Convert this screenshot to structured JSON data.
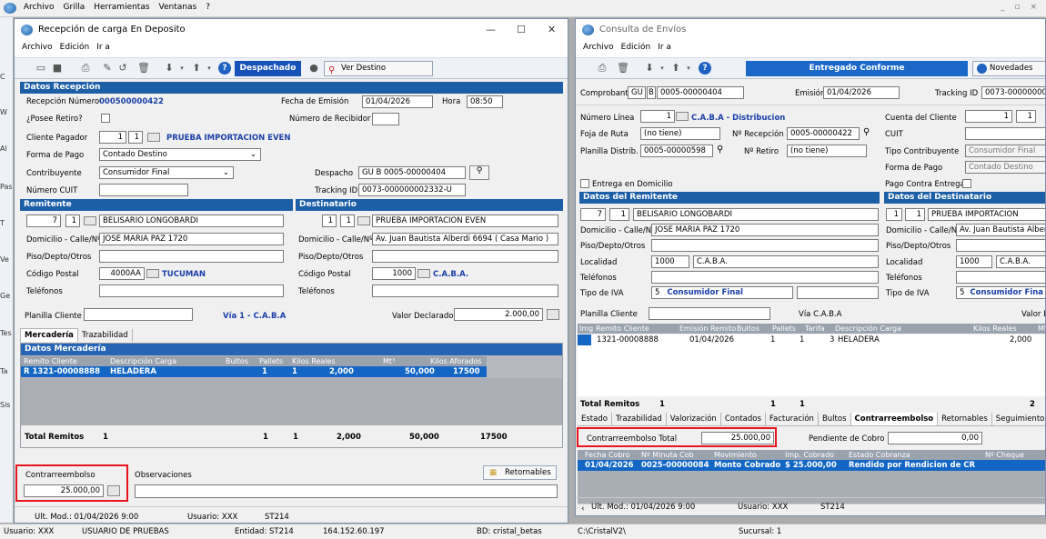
{
  "app": {
    "menu": [
      "Archivo",
      "Grilla",
      "Herramientas",
      "Ventanas",
      "?"
    ],
    "win_controls": "_ ▫ ×"
  },
  "sidebar": [
    "C",
    "W",
    "Al",
    "Pas",
    "T",
    "Ve",
    "Ge",
    "Tes",
    "Ta",
    "Sis"
  ],
  "left": {
    "title": "Recepción de carga En Deposito",
    "menu": [
      "Archivo",
      "Edición",
      "Ir a"
    ],
    "toolbar": {
      "status_label": "Despachado",
      "dest_label": "Ver Destino"
    },
    "datos": {
      "section": "Datos Recepción",
      "recep_label": "Recepción Número",
      "recep_val": "000500000422",
      "fecha_label": "Fecha de Emisión",
      "fecha_val": "01/04/2026",
      "hora_label": "Hora",
      "hora_val": "08:50",
      "retiro_label": "¿Posee Retiro?",
      "recibidor_label": "Número de Recibidor",
      "pagador_label": "Cliente Pagador",
      "pagador_n1": "1",
      "pagador_n2": "1",
      "pagador_name": "PRUEBA IMPORTACION EVEN",
      "forma_label": "Forma de Pago",
      "forma_val": "Contado Destino",
      "contrib_label": "Contribuyente",
      "contrib_val": "Consumidor Final",
      "despacho_label": "Despacho",
      "despacho_val": "GU B 0005-00000404",
      "cuit_label": "Número CUIT",
      "tracking_label": "Tracking ID",
      "tracking_val": "0073-000000002332-U"
    },
    "remitente": {
      "section": "Remitente",
      "n1": "7",
      "n2": "1",
      "name": "BELISARIO LONGOBARDI",
      "dom_label": "Domicilio - Calle/Nº",
      "dom": "JOSE MARIA PAZ 1720",
      "piso_label": "Piso/Depto/Otros",
      "cp_label": "Código Postal",
      "cp": "4000AA",
      "city": "TUCUMAN",
      "tel_label": "Teléfonos"
    },
    "destinatario": {
      "section": "Destinatario",
      "n1": "1",
      "n2": "1",
      "name": "PRUEBA IMPORTACION EVEN",
      "dom_label": "Domicilio - Calle/Nº",
      "dom": "Av. Juan Bautista Alberdi 6694 ( Casa Mario )",
      "piso_label": "Piso/Depto/Otros",
      "cp_label": "Código Postal",
      "cp": "1000",
      "city": "C.A.B.A.",
      "tel_label": "Teléfonos"
    },
    "planilla_label": "Planilla Cliente",
    "via": "Vía  1 - C.A.B.A",
    "valor_label": "Valor Declarado",
    "valor": "2.000,00",
    "tabs": [
      "Mercadería",
      "Trazabilidad"
    ],
    "merc": {
      "section": "Datos Mercadería",
      "headers": [
        "Remito Cliente",
        "Descripción Carga",
        "Bultos",
        "Pallets",
        "Kilos Reales",
        "Mt³",
        "Kilos Aforados"
      ],
      "row": [
        "R 1321-00008888",
        "HELADERA",
        "1",
        "1",
        "2,000",
        "50,000",
        "17500"
      ],
      "totals_label": "Total Remitos",
      "totals": [
        "1",
        "1",
        "1",
        "2,000",
        "50,000",
        "17500"
      ]
    },
    "contra_label": "Contrarreembolso",
    "contra_val": "25.000,00",
    "obs_label": "Observaciones",
    "retornables": "Retornables",
    "status": {
      "mod": "Ult. Mod.: 01/04/2026 9:00",
      "user": "Usuario: XXX",
      "code": "ST214"
    }
  },
  "right": {
    "title": "Consulta de Envíos",
    "menu": [
      "Archivo",
      "Edición",
      "Ir a"
    ],
    "toolbar": {
      "status_label": "Entregado Conforme",
      "novedades": "Novedades"
    },
    "comprobante_label": "Comprobante",
    "comp_a": "GU",
    "comp_b": "B",
    "comp_c": "0005-00000404",
    "emision_label": "Emisión",
    "emision_val": "01/04/2026",
    "tracking_label": "Tracking ID",
    "tracking_val": "0073-000000002",
    "linea_label": "Número Línea",
    "linea_n": "1",
    "linea_name": "C.A.B.A - Distribucion",
    "cuenta_label": "Cuenta del Cliente",
    "cuenta_n1": "1",
    "cuenta_n2": "1",
    "foja_label": "Foja de Ruta",
    "foja_val": "(no tiene)",
    "nrecep_label": "Nº Recepción",
    "nrecep_val": "0005-00000422",
    "cuit_label": "CUIT",
    "planilla_label": "Planilla Distrib.",
    "planilla_val": "0005-00000598",
    "nretiro_label": "Nº Retiro",
    "nretiro_val": "(no tiene)",
    "tipo_label": "Tipo Contribuyente",
    "tipo_val": "Consumidor Final",
    "forma_label": "Forma de Pago",
    "forma_val": "Contado Destino",
    "entrega_label": "Entrega en Domicilio",
    "pce_label": "Pago Contra Entrega",
    "rem": {
      "section": "Datos del Remitente",
      "n1": "7",
      "n2": "1",
      "name": "BELISARIO LONGOBARDI",
      "dom_label": "Domicilio - Calle/Nº",
      "dom": "JOSE MARIA PAZ 1720",
      "piso_label": "Piso/Depto/Otros",
      "loc_label": "Localidad",
      "loc_cp": "1000",
      "loc": "C.A.B.A.",
      "tel_label": "Teléfonos",
      "iva_label": "Tipo de IVA",
      "iva_n": "5",
      "iva": "Consumidor Final"
    },
    "dest": {
      "section": "Datos del Destinatario",
      "n1": "1",
      "n2": "1",
      "name": "PRUEBA IMPORTACION",
      "dom_label": "Domicilio - Calle/Nº",
      "dom": "Av. Juan Bautista Alber",
      "piso_label": "Piso/Depto/Otros",
      "loc_label": "Localidad",
      "loc_cp": "1000",
      "loc": "C.A.B.A.",
      "tel_label": "Teléfonos",
      "iva_label": "Tipo de IVA",
      "iva_n": "5",
      "iva": "Consumidor Fina"
    },
    "planilla_cli_label": "Planilla Cliente",
    "via": "Vía C.A.B.A",
    "valor_label": "Valor De",
    "grid": {
      "headers": [
        "Img",
        "Remito Cliente",
        "Emisión Remito",
        "Bultos",
        "Pallets",
        "Tarifa",
        "Descripción Carga",
        "Kilos Reales",
        "Mt"
      ],
      "row": [
        "1321-00008888",
        "01/04/2026",
        "1",
        "1",
        "3",
        "HELADERA",
        "2,000"
      ],
      "totals_label": "Total Remitos",
      "totals": [
        "1",
        "1",
        "1",
        "2"
      ]
    },
    "tabs": [
      "Estado",
      "Trazabilidad",
      "Valorización",
      "Contados",
      "Facturación",
      "Bultos",
      "Contrarreembolso",
      "Retornables",
      "Seguimiento"
    ],
    "contra_total_label": "Contrarreembolso Total",
    "contra_total": "25.000,00",
    "pendiente_label": "Pendiente de Cobro",
    "pendiente": "0,00",
    "cobro": {
      "headers": [
        "Fecha Cobro",
        "Nº Minuta Cob",
        "Movimiento",
        "Imp. Cobrado",
        "Estado Cobranza",
        "Nº Cheque"
      ],
      "row": [
        "01/04/2026",
        "0025-00000084",
        "Monto Cobrado",
        "$ 25.000,00",
        "Rendido por Rendicion de CR"
      ]
    },
    "status": {
      "mod": "Ult. Mod.: 01/04/2026 9:00",
      "user": "Usuario: XXX",
      "code": "ST214"
    }
  },
  "statusbar": {
    "user": "Usuario: XXX",
    "name": "USUARIO DE PRUEBAS",
    "entidad": "Entidad: ST214",
    "ip": "164.152.60.197",
    "bd": "BD: cristal_betas",
    "path": "C:\\CristalV2\\",
    "sucursal": "Sucursal: 1"
  }
}
